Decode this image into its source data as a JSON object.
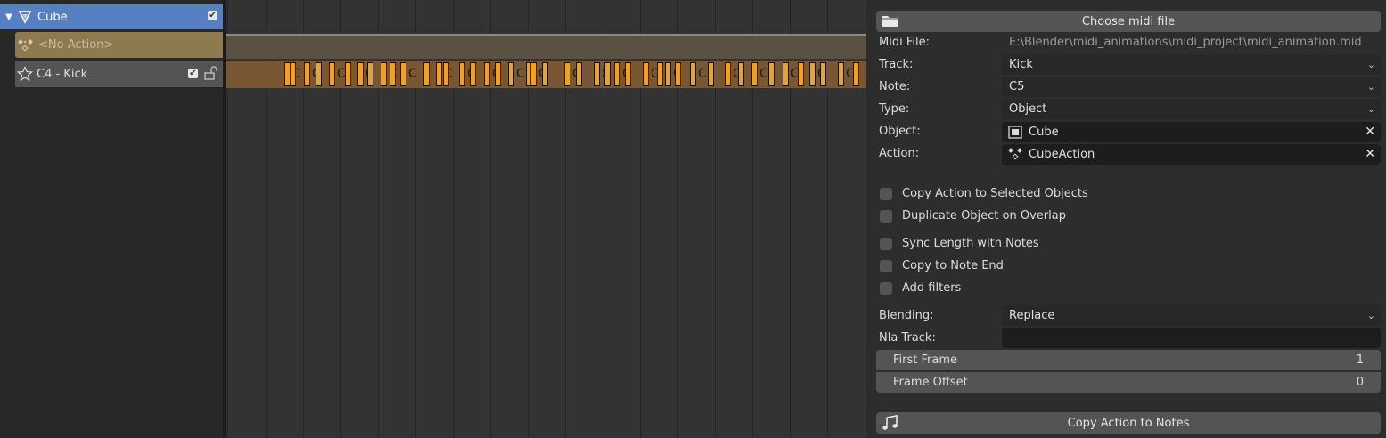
{
  "channels": {
    "cube": {
      "label": "Cube"
    },
    "no_action": {
      "label": "<No Action>"
    },
    "kick": {
      "label": "C4 - Kick"
    }
  },
  "timeline": {
    "strip_letter": "C"
  },
  "panel": {
    "choose_midi_label": "Choose midi file",
    "fields": {
      "midi_file": {
        "label": "Midi File:",
        "value": "E:\\Blender\\midi_animations\\midi_project\\midi_animation.mid"
      },
      "track": {
        "label": "Track:",
        "value": "Kick"
      },
      "note": {
        "label": "Note:",
        "value": "C5"
      },
      "type": {
        "label": "Type:",
        "value": "Object"
      },
      "object": {
        "label": "Object:",
        "value": "Cube"
      },
      "action": {
        "label": "Action:",
        "value": "CubeAction"
      }
    },
    "checkboxes": {
      "copy_to_selected": "Copy Action to Selected Objects",
      "duplicate_on_overlap": "Duplicate Object on Overlap",
      "sync_length": "Sync Length with Notes",
      "copy_to_note_end": "Copy to Note End",
      "add_filters": "Add filters"
    },
    "blending": {
      "label": "Blending:",
      "value": "Replace"
    },
    "nla_track": {
      "label": "Nla Track:",
      "value": ""
    },
    "first_frame": {
      "label": "First Frame",
      "value": "1"
    },
    "frame_offset": {
      "label": "Frame Offset",
      "value": "0"
    },
    "copy_action_label": "Copy Action to Notes"
  },
  "colors": {
    "selected_channel": "#5680c2",
    "strip": "#f0a21b",
    "kick_track": "#7a5733"
  }
}
